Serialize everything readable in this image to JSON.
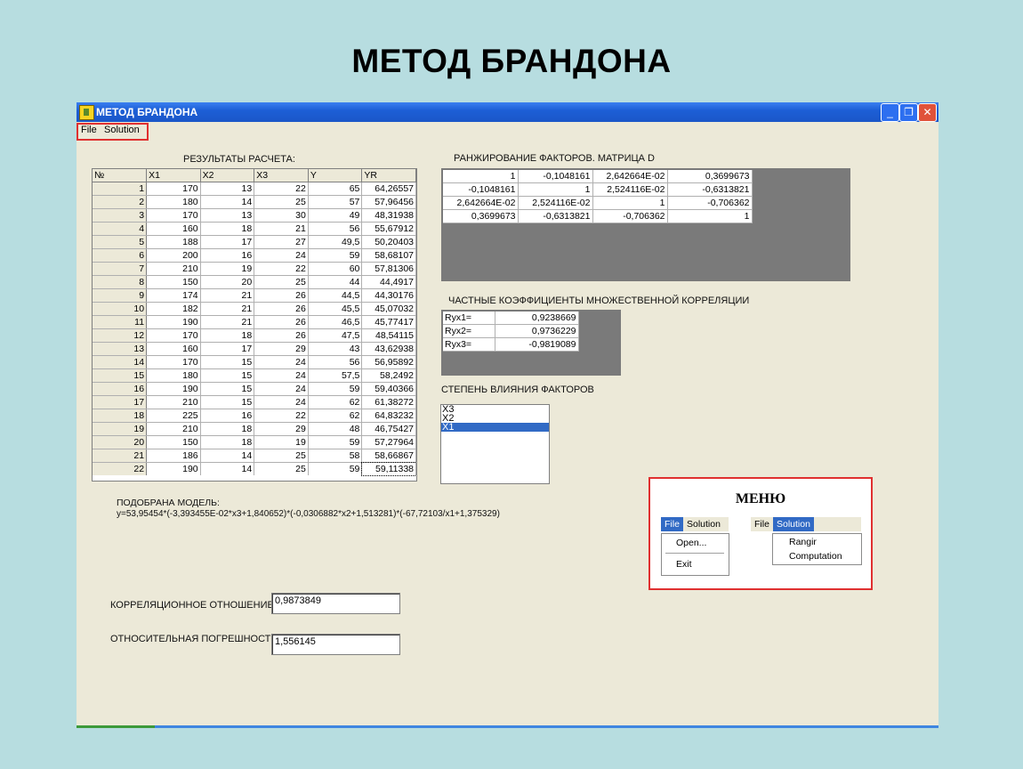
{
  "slide_title": "МЕТОД БРАНДОНА",
  "window": {
    "title": "МЕТОД БРАНДОНА",
    "menu": [
      "File",
      "Solution"
    ]
  },
  "results": {
    "label": "РЕЗУЛЬТАТЫ РАСЧЕТА:",
    "headers": [
      "№",
      "X1",
      "X2",
      "X3",
      "Y",
      "YR"
    ],
    "rows": [
      [
        "1",
        "170",
        "13",
        "22",
        "65",
        "64,26557"
      ],
      [
        "2",
        "180",
        "14",
        "25",
        "57",
        "57,96456"
      ],
      [
        "3",
        "170",
        "13",
        "30",
        "49",
        "48,31938"
      ],
      [
        "4",
        "160",
        "18",
        "21",
        "56",
        "55,67912"
      ],
      [
        "5",
        "188",
        "17",
        "27",
        "49,5",
        "50,20403"
      ],
      [
        "6",
        "200",
        "16",
        "24",
        "59",
        "58,68107"
      ],
      [
        "7",
        "210",
        "19",
        "22",
        "60",
        "57,81306"
      ],
      [
        "8",
        "150",
        "20",
        "25",
        "44",
        "44,4917"
      ],
      [
        "9",
        "174",
        "21",
        "26",
        "44,5",
        "44,30176"
      ],
      [
        "10",
        "182",
        "21",
        "26",
        "45,5",
        "45,07032"
      ],
      [
        "11",
        "190",
        "21",
        "26",
        "46,5",
        "45,77417"
      ],
      [
        "12",
        "170",
        "18",
        "26",
        "47,5",
        "48,54115"
      ],
      [
        "13",
        "160",
        "17",
        "29",
        "43",
        "43,62938"
      ],
      [
        "14",
        "170",
        "15",
        "24",
        "56",
        "56,95892"
      ],
      [
        "15",
        "180",
        "15",
        "24",
        "57,5",
        "58,2492"
      ],
      [
        "16",
        "190",
        "15",
        "24",
        "59",
        "59,40366"
      ],
      [
        "17",
        "210",
        "15",
        "24",
        "62",
        "61,38272"
      ],
      [
        "18",
        "225",
        "16",
        "22",
        "62",
        "64,83232"
      ],
      [
        "19",
        "210",
        "18",
        "29",
        "48",
        "46,75427"
      ],
      [
        "20",
        "150",
        "18",
        "19",
        "59",
        "57,27964"
      ],
      [
        "21",
        "186",
        "14",
        "25",
        "58",
        "58,66867"
      ],
      [
        "22",
        "190",
        "14",
        "25",
        "59",
        "59,11338"
      ]
    ]
  },
  "model": {
    "label": "ПОДОБРАНА МОДЕЛЬ:",
    "formula": "y=53,95454*(-3,393455E-02*x3+1,840652)*(-0,0306882*x2+1,513281)*(-67,72103/x1+1,375329)"
  },
  "ranking": {
    "label": "РАНЖИРОВАНИЕ ФАКТОРОВ. МАТРИЦА D",
    "rows": [
      [
        "1",
        "-0,1048161",
        "2,642664E-02",
        "0,3699673"
      ],
      [
        "-0,1048161",
        "1",
        "2,524116E-02",
        "-0,6313821"
      ],
      [
        "2,642664E-02",
        "2,524116E-02",
        "1",
        "-0,706362"
      ],
      [
        "0,3699673",
        "-0,6313821",
        "-0,706362",
        "1"
      ]
    ]
  },
  "partial_corr": {
    "label": "ЧАСТНЫЕ КОЭФФИЦИЕНТЫ МНОЖЕСТВЕННОЙ КОРРЕЛЯЦИИ",
    "rows": [
      [
        "Ryx1=",
        "0,9238669"
      ],
      [
        "Ryx2=",
        "0,9736229"
      ],
      [
        "Ryx3=",
        "-0,9819089"
      ]
    ]
  },
  "influence": {
    "label": "СТЕПЕНЬ ВЛИЯНИЯ ФАКТОРОВ",
    "items": [
      "X3",
      "X2",
      "X1"
    ],
    "selected": "X1"
  },
  "corr_ratio": {
    "label": "КОРРЕЛЯЦИОННОЕ ОТНОШЕНИЕ:",
    "value": "0,9873849"
  },
  "rel_error": {
    "label": "ОТНОСИТЕЛЬНАЯ ПОГРЕШНОСТЬ:",
    "value": "1,556145"
  },
  "menu_panel": {
    "title": "МЕНЮ",
    "left_bar": [
      "File",
      "Solution"
    ],
    "left_items": [
      "Open...",
      "Exit"
    ],
    "right_bar": [
      "File",
      "Solution"
    ],
    "right_items": [
      "Rangir",
      "Computation"
    ]
  }
}
